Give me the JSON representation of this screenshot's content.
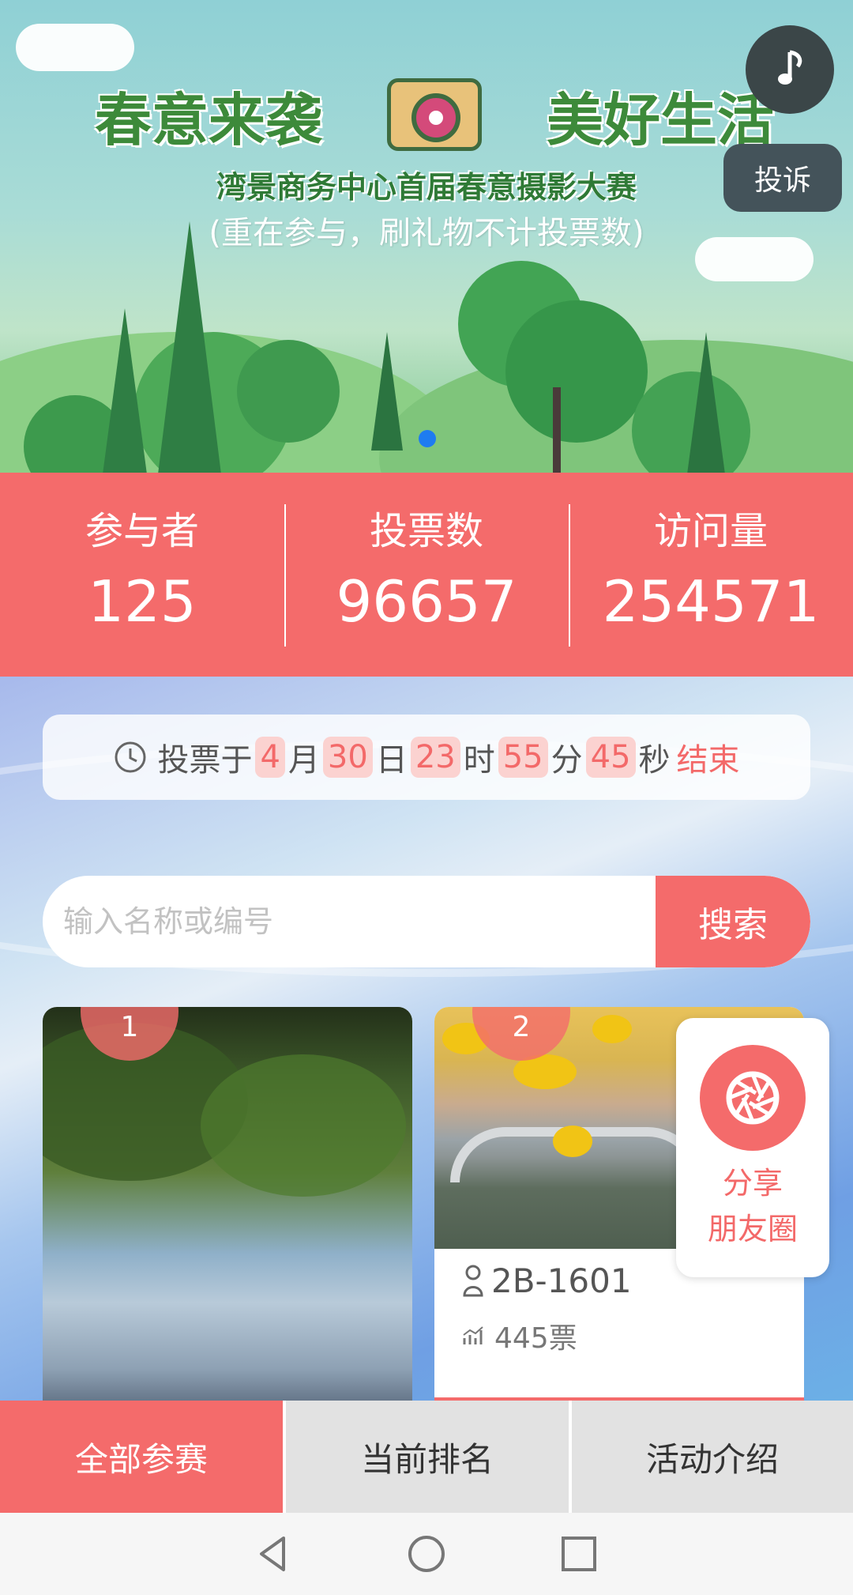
{
  "banner": {
    "title_left": "春意来袭",
    "title_right": "美好生活",
    "subtitle": "湾景商务中心首届春意摄影大赛",
    "note": "(重在参与，刷礼物不计投票数)",
    "music_icon": "music-note-icon",
    "complain_label": "投诉"
  },
  "stats": [
    {
      "label": "参与者",
      "value": "125"
    },
    {
      "label": "投票数",
      "value": "96657"
    },
    {
      "label": "访问量",
      "value": "254571"
    }
  ],
  "countdown": {
    "prefix": "投票于",
    "month": "4",
    "month_unit": "月",
    "day": "30",
    "day_unit": "日",
    "hour": "23",
    "hour_unit": "时",
    "minute": "55",
    "minute_unit": "分",
    "second": "45",
    "second_unit": "秒",
    "end_label": "结束"
  },
  "search": {
    "placeholder": "输入名称或编号",
    "button_label": "搜索"
  },
  "entries": [
    {
      "rank": "1"
    },
    {
      "rank": "2",
      "code": "2B-1601",
      "votes": "445票"
    }
  ],
  "share": {
    "line1": "分享",
    "line2": "朋友圈"
  },
  "tabs": [
    {
      "label": "全部参赛"
    },
    {
      "label": "当前排名"
    },
    {
      "label": "活动介绍"
    }
  ],
  "colors": {
    "accent": "#f46b6b",
    "highlight_bg": "#fbd2d0",
    "tab_inactive": "#e2e2e2"
  }
}
